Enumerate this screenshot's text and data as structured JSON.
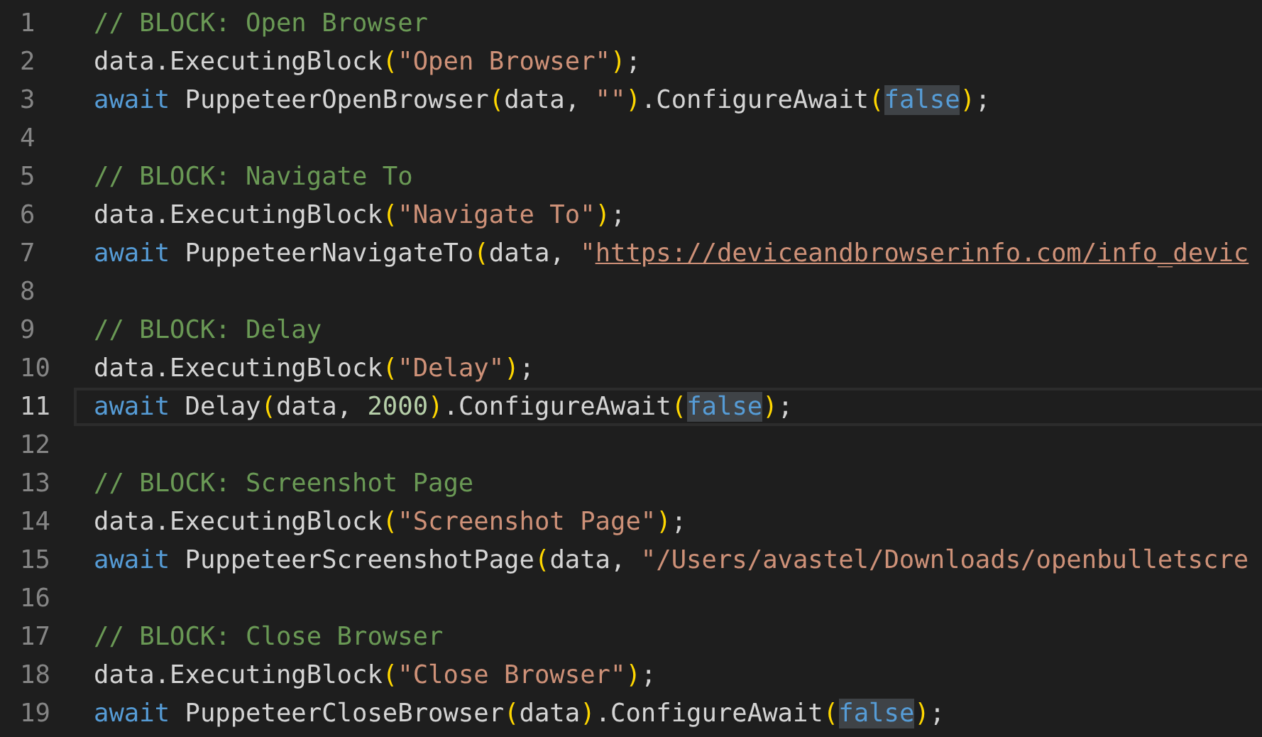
{
  "editor": {
    "lines": [
      {
        "number": "1",
        "selected": false,
        "tokens": [
          {
            "kind": "comment",
            "text": "// BLOCK: Open Browser"
          }
        ]
      },
      {
        "number": "2",
        "selected": false,
        "tokens": [
          {
            "kind": "plain",
            "text": "data.ExecutingBlock"
          },
          {
            "kind": "paren",
            "text": "("
          },
          {
            "kind": "string",
            "text": "\"Open Browser\""
          },
          {
            "kind": "paren",
            "text": ")"
          },
          {
            "kind": "plain",
            "text": ";"
          }
        ]
      },
      {
        "number": "3",
        "selected": false,
        "tokens": [
          {
            "kind": "keyword",
            "text": "await"
          },
          {
            "kind": "plain",
            "text": " PuppeteerOpenBrowser"
          },
          {
            "kind": "paren",
            "text": "("
          },
          {
            "kind": "plain",
            "text": "data, "
          },
          {
            "kind": "string",
            "text": "\"\""
          },
          {
            "kind": "paren",
            "text": ")"
          },
          {
            "kind": "plain",
            "text": ".ConfigureAwait"
          },
          {
            "kind": "paren",
            "text": "("
          },
          {
            "kind": "keyword-match",
            "text": "false"
          },
          {
            "kind": "paren",
            "text": ")"
          },
          {
            "kind": "plain",
            "text": ";"
          }
        ]
      },
      {
        "number": "4",
        "selected": false
      },
      {
        "number": "5",
        "selected": false,
        "tokens": [
          {
            "kind": "comment",
            "text": "// BLOCK: Navigate To"
          }
        ]
      },
      {
        "number": "6",
        "selected": false,
        "tokens": [
          {
            "kind": "plain",
            "text": "data.ExecutingBlock"
          },
          {
            "kind": "paren",
            "text": "("
          },
          {
            "kind": "string",
            "text": "\"Navigate To\""
          },
          {
            "kind": "paren",
            "text": ")"
          },
          {
            "kind": "plain",
            "text": ";"
          }
        ]
      },
      {
        "number": "7",
        "selected": false,
        "tokens": [
          {
            "kind": "keyword",
            "text": "await"
          },
          {
            "kind": "plain",
            "text": " PuppeteerNavigateTo"
          },
          {
            "kind": "paren",
            "text": "("
          },
          {
            "kind": "plain",
            "text": "data, "
          },
          {
            "kind": "string",
            "text": "\""
          },
          {
            "kind": "link",
            "text": "https://deviceandbrowserinfo.com/info_devic"
          }
        ]
      },
      {
        "number": "8",
        "selected": false
      },
      {
        "number": "9",
        "selected": false,
        "tokens": [
          {
            "kind": "comment",
            "text": "// BLOCK: Delay"
          }
        ]
      },
      {
        "number": "10",
        "selected": false,
        "tokens": [
          {
            "kind": "plain",
            "text": "data.ExecutingBlock"
          },
          {
            "kind": "paren",
            "text": "("
          },
          {
            "kind": "string",
            "text": "\"Delay\""
          },
          {
            "kind": "paren",
            "text": ")"
          },
          {
            "kind": "plain",
            "text": ";"
          }
        ]
      },
      {
        "number": "11",
        "selected": true,
        "tokens": [
          {
            "kind": "keyword",
            "text": "await"
          },
          {
            "kind": "plain",
            "text": " Delay"
          },
          {
            "kind": "paren",
            "text": "("
          },
          {
            "kind": "plain",
            "text": "data, "
          },
          {
            "kind": "number",
            "text": "2000"
          },
          {
            "kind": "paren",
            "text": ")"
          },
          {
            "kind": "plain",
            "text": ".ConfigureAwait"
          },
          {
            "kind": "paren",
            "text": "("
          },
          {
            "kind": "keyword-match",
            "text": "false"
          },
          {
            "kind": "paren",
            "text": ")"
          },
          {
            "kind": "plain",
            "text": ";"
          }
        ]
      },
      {
        "number": "12",
        "selected": false
      },
      {
        "number": "13",
        "selected": false,
        "tokens": [
          {
            "kind": "comment",
            "text": "// BLOCK: Screenshot Page"
          }
        ]
      },
      {
        "number": "14",
        "selected": false,
        "tokens": [
          {
            "kind": "plain",
            "text": "data.ExecutingBlock"
          },
          {
            "kind": "paren",
            "text": "("
          },
          {
            "kind": "string",
            "text": "\"Screenshot Page\""
          },
          {
            "kind": "paren",
            "text": ")"
          },
          {
            "kind": "plain",
            "text": ";"
          }
        ]
      },
      {
        "number": "15",
        "selected": false,
        "tokens": [
          {
            "kind": "keyword",
            "text": "await"
          },
          {
            "kind": "plain",
            "text": " PuppeteerScreenshotPage"
          },
          {
            "kind": "paren",
            "text": "("
          },
          {
            "kind": "plain",
            "text": "data, "
          },
          {
            "kind": "string",
            "text": "\"/Users/avastel/Downloads/openbulletscre"
          }
        ]
      },
      {
        "number": "16",
        "selected": false
      },
      {
        "number": "17",
        "selected": false,
        "tokens": [
          {
            "kind": "comment",
            "text": "// BLOCK: Close Browser"
          }
        ]
      },
      {
        "number": "18",
        "selected": false,
        "tokens": [
          {
            "kind": "plain",
            "text": "data.ExecutingBlock"
          },
          {
            "kind": "paren",
            "text": "("
          },
          {
            "kind": "string",
            "text": "\"Close Browser\""
          },
          {
            "kind": "paren",
            "text": ")"
          },
          {
            "kind": "plain",
            "text": ";"
          }
        ]
      },
      {
        "number": "19",
        "selected": false,
        "tokens": [
          {
            "kind": "keyword",
            "text": "await"
          },
          {
            "kind": "plain",
            "text": " PuppeteerCloseBrowser"
          },
          {
            "kind": "paren",
            "text": "("
          },
          {
            "kind": "plain",
            "text": "data"
          },
          {
            "kind": "paren",
            "text": ")"
          },
          {
            "kind": "plain",
            "text": ".ConfigureAwait"
          },
          {
            "kind": "paren",
            "text": "("
          },
          {
            "kind": "keyword-match",
            "text": "false"
          },
          {
            "kind": "paren",
            "text": ")"
          },
          {
            "kind": "plain",
            "text": ";"
          }
        ]
      }
    ]
  }
}
